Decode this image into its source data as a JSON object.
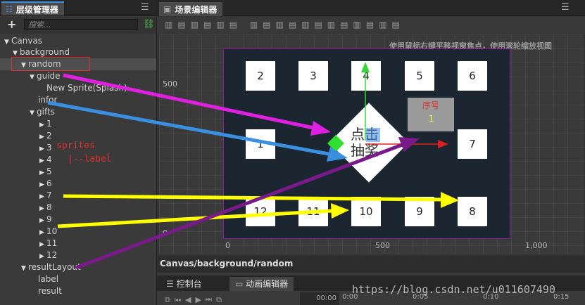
{
  "hierarchy": {
    "title": "层级管理器",
    "search_placeholder": "搜索...",
    "nodes": [
      {
        "label": "Canvas"
      },
      {
        "label": "background"
      },
      {
        "label": "random"
      },
      {
        "label": "guide"
      },
      {
        "label": "New Sprite(Splash)"
      },
      {
        "label": "infor"
      },
      {
        "label": "gifts"
      },
      {
        "label": "1"
      },
      {
        "label": "2"
      },
      {
        "label": "3"
      },
      {
        "label": "4"
      },
      {
        "label": "5"
      },
      {
        "label": "6"
      },
      {
        "label": "7"
      },
      {
        "label": "8"
      },
      {
        "label": "9"
      },
      {
        "label": "10"
      },
      {
        "label": "11"
      },
      {
        "label": "12"
      },
      {
        "label": "resultLayout"
      },
      {
        "label": "label"
      },
      {
        "label": "result"
      }
    ],
    "annotation_sprites": "sprites",
    "annotation_label": "|--label"
  },
  "scene": {
    "title": "场景编辑器",
    "hint": "使用鼠标右键平移视窗焦点，使用滚轮缩放视图",
    "ruler_y_500": "500",
    "ruler_y_0": "0",
    "ruler_x_0": "0",
    "ruler_x_500": "500",
    "ruler_x_1000": "1,000",
    "boxes": [
      "1",
      "2",
      "3",
      "4",
      "5",
      "6",
      "7",
      "8",
      "9",
      "10",
      "11",
      "12"
    ],
    "center_text_1": "点击",
    "center_text_2": "抽奖",
    "serial_label": "序号",
    "serial_value": "1",
    "path": "Canvas/background/random"
  },
  "bottom": {
    "tab_console": "控制台",
    "tab_animation": "动画编辑器",
    "time_0": "00:00",
    "time_1": "0:00",
    "time_2": "0:05",
    "time_3": "0:10",
    "time_4": "0:15"
  },
  "watermark": "https://blog.csdn.net/u011607490",
  "colors": {
    "accent": "#3b8fe0",
    "magenta": "#e020e0",
    "blue": "#3a90e0",
    "yellow": "#ffff00",
    "purple": "#7a1a8a"
  }
}
